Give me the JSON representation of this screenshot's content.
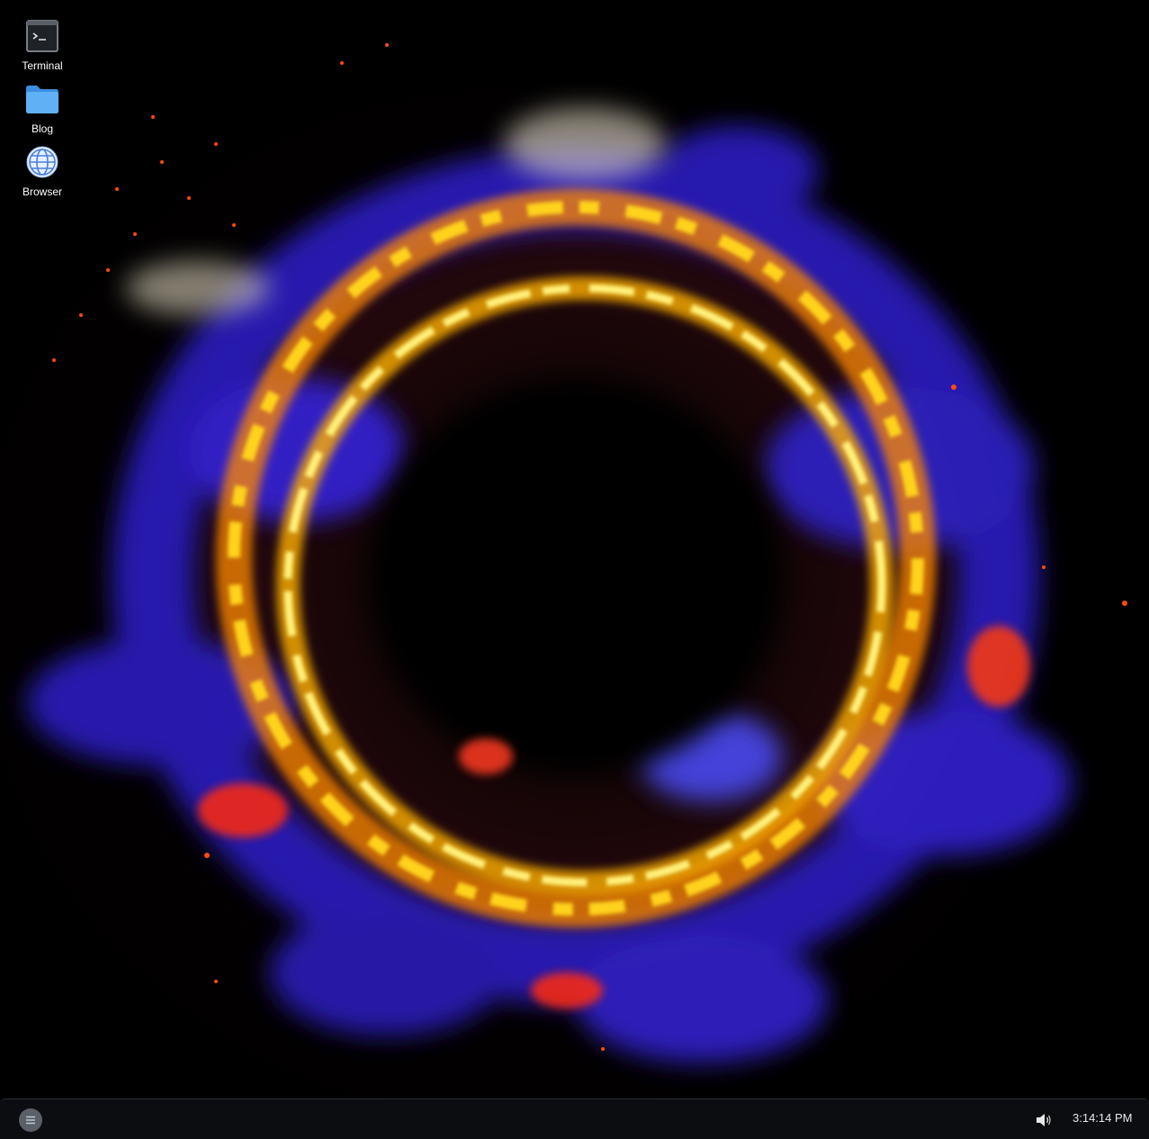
{
  "desktop": {
    "icons": [
      {
        "label": "Terminal",
        "icon": "terminal-icon"
      },
      {
        "label": "Blog",
        "icon": "folder-icon"
      },
      {
        "label": "Browser",
        "icon": "globe-icon"
      }
    ],
    "wallpaper": "fire-ring"
  },
  "taskbar": {
    "start_icon": "menu-icon",
    "volume_icon": "speaker-icon",
    "clock": "3:14:14 PM"
  },
  "colors": {
    "taskbar_bg": "#0b0d10",
    "folder_blue": "#4aa3f0",
    "fire_yellow": "#ffd21a",
    "flame_blue": "#3b2fd0"
  }
}
